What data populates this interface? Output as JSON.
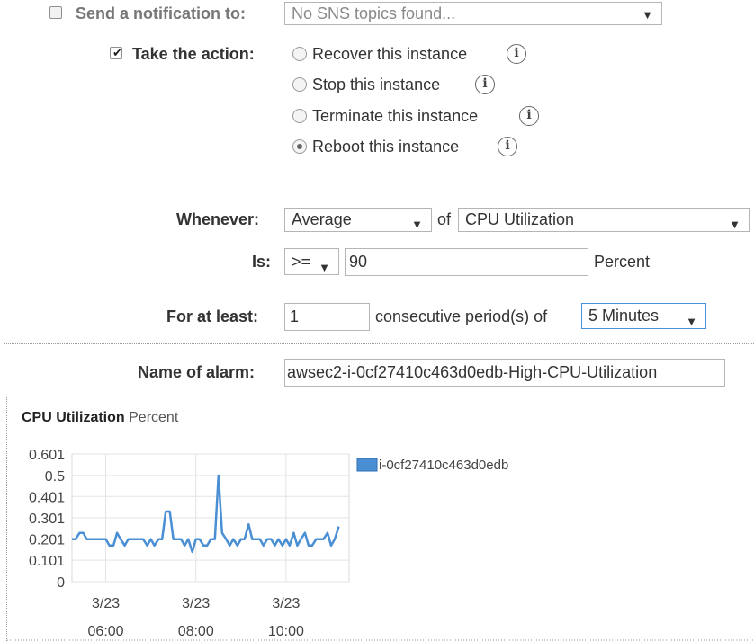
{
  "notification": {
    "label": "Send a notification to:",
    "checked": false,
    "topic_value": "No SNS topics found...",
    "arrow": "▼"
  },
  "action": {
    "label": "Take the action:",
    "checked": true,
    "check_glyph": "✔",
    "options": [
      {
        "label": "Recover this instance",
        "selected": false
      },
      {
        "label": "Stop this instance",
        "selected": false
      },
      {
        "label": "Terminate this instance",
        "selected": false
      },
      {
        "label": "Reboot this instance",
        "selected": true
      }
    ],
    "info_glyph": "i"
  },
  "condition": {
    "whenever_label": "Whenever:",
    "statistic": "Average",
    "of_label": "of",
    "metric": "CPU Utilization",
    "is_label": "Is:",
    "operator": ">=",
    "threshold": "90",
    "unit": "Percent",
    "for_label": "For at least:",
    "periods": "1",
    "periods_text": "consecutive period(s) of",
    "period_length": "5 Minutes"
  },
  "alarm": {
    "name_label": "Name of alarm:",
    "name_value": "awsec2-i-0cf27410c463d0edb-High-CPU-Utilization"
  },
  "chart_title": "CPU Utilization",
  "chart_unit": "Percent",
  "chart_data": {
    "type": "line",
    "title": "CPU Utilization",
    "subtitle": "Percent",
    "xlabel": "",
    "ylabel": "",
    "ylim": [
      0,
      0.601
    ],
    "y_ticks": [
      "0.601",
      "0.5",
      "0.401",
      "0.301",
      "0.201",
      "0.101",
      "0"
    ],
    "y_tick_values": [
      0.601,
      0.5,
      0.401,
      0.301,
      0.201,
      0.101,
      0
    ],
    "x_ticks": [
      {
        "date": "3/23",
        "time": "06:00",
        "t": 6.0
      },
      {
        "date": "3/23",
        "time": "08:00",
        "t": 8.0
      },
      {
        "date": "3/23",
        "time": "10:00",
        "t": 10.0
      }
    ],
    "xlim": [
      5.25,
      11.4
    ],
    "grid": true,
    "legend_position": "right",
    "series": [
      {
        "name": "i-0cf27410c463d0edb",
        "color": "#4a8fd4",
        "x": [
          5.25,
          5.33,
          5.42,
          5.5,
          5.58,
          5.67,
          5.75,
          5.83,
          5.92,
          6.0,
          6.08,
          6.17,
          6.25,
          6.33,
          6.42,
          6.5,
          6.58,
          6.67,
          6.75,
          6.83,
          6.92,
          7.0,
          7.08,
          7.17,
          7.25,
          7.33,
          7.42,
          7.5,
          7.58,
          7.67,
          7.75,
          7.83,
          7.92,
          8.0,
          8.08,
          8.17,
          8.25,
          8.33,
          8.42,
          8.5,
          8.58,
          8.67,
          8.75,
          8.83,
          8.92,
          9.0,
          9.08,
          9.17,
          9.25,
          9.33,
          9.42,
          9.5,
          9.58,
          9.67,
          9.75,
          9.83,
          9.92,
          10.0,
          10.08,
          10.17,
          10.25,
          10.33,
          10.42,
          10.5,
          10.58,
          10.67,
          10.75,
          10.83,
          10.92,
          11.0,
          11.08,
          11.17
        ],
        "values": [
          0.2,
          0.2,
          0.23,
          0.23,
          0.2,
          0.2,
          0.2,
          0.2,
          0.2,
          0.2,
          0.17,
          0.17,
          0.23,
          0.2,
          0.17,
          0.2,
          0.2,
          0.2,
          0.2,
          0.2,
          0.17,
          0.2,
          0.17,
          0.2,
          0.2,
          0.33,
          0.33,
          0.2,
          0.2,
          0.2,
          0.17,
          0.2,
          0.14,
          0.2,
          0.2,
          0.17,
          0.17,
          0.2,
          0.2,
          0.5,
          0.23,
          0.2,
          0.17,
          0.2,
          0.17,
          0.2,
          0.2,
          0.27,
          0.2,
          0.2,
          0.2,
          0.17,
          0.2,
          0.2,
          0.17,
          0.2,
          0.17,
          0.2,
          0.17,
          0.23,
          0.17,
          0.2,
          0.23,
          0.17,
          0.17,
          0.2,
          0.2,
          0.2,
          0.23,
          0.17,
          0.2,
          0.26
        ]
      }
    ]
  }
}
